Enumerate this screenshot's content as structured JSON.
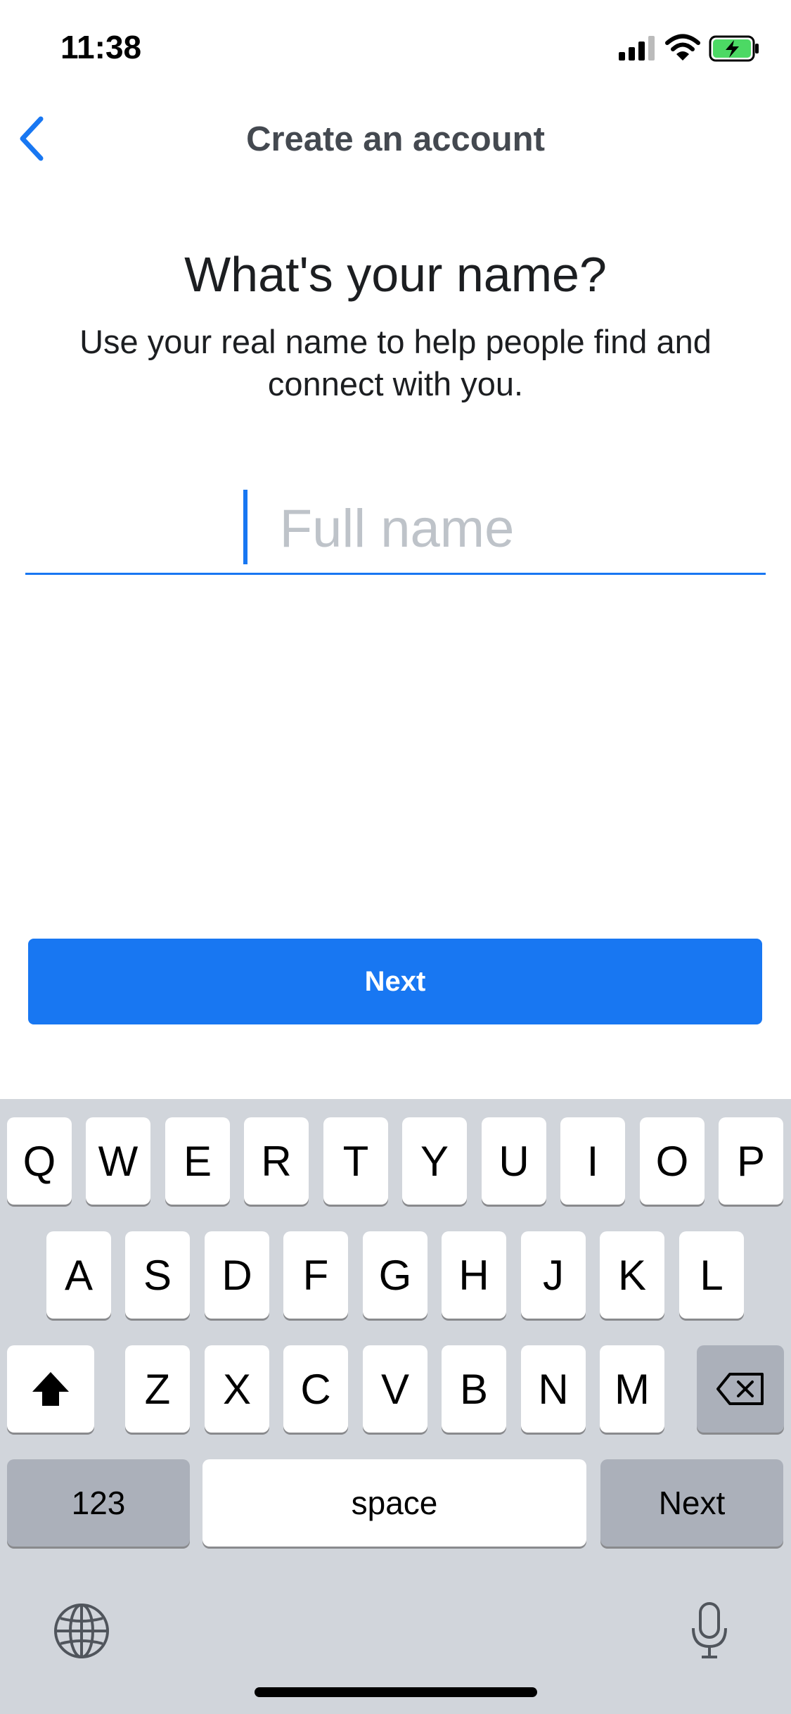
{
  "status_bar": {
    "time": "11:38"
  },
  "nav": {
    "title": "Create an account"
  },
  "content": {
    "heading": "What's your name?",
    "subtitle": "Use your real name to help people find and connect with you.",
    "name_placeholder": "Full name",
    "name_value": ""
  },
  "next_button": {
    "label": "Next"
  },
  "keyboard": {
    "row1": [
      "Q",
      "W",
      "E",
      "R",
      "T",
      "Y",
      "U",
      "I",
      "O",
      "P"
    ],
    "row2": [
      "A",
      "S",
      "D",
      "F",
      "G",
      "H",
      "J",
      "K",
      "L"
    ],
    "row3": [
      "Z",
      "X",
      "C",
      "V",
      "B",
      "N",
      "M"
    ],
    "numbers_label": "123",
    "space_label": "space",
    "return_label": "Next"
  },
  "colors": {
    "accent": "#1877f2",
    "keyboard_bg": "#d1d5db",
    "key_dark": "#abb0ba"
  }
}
